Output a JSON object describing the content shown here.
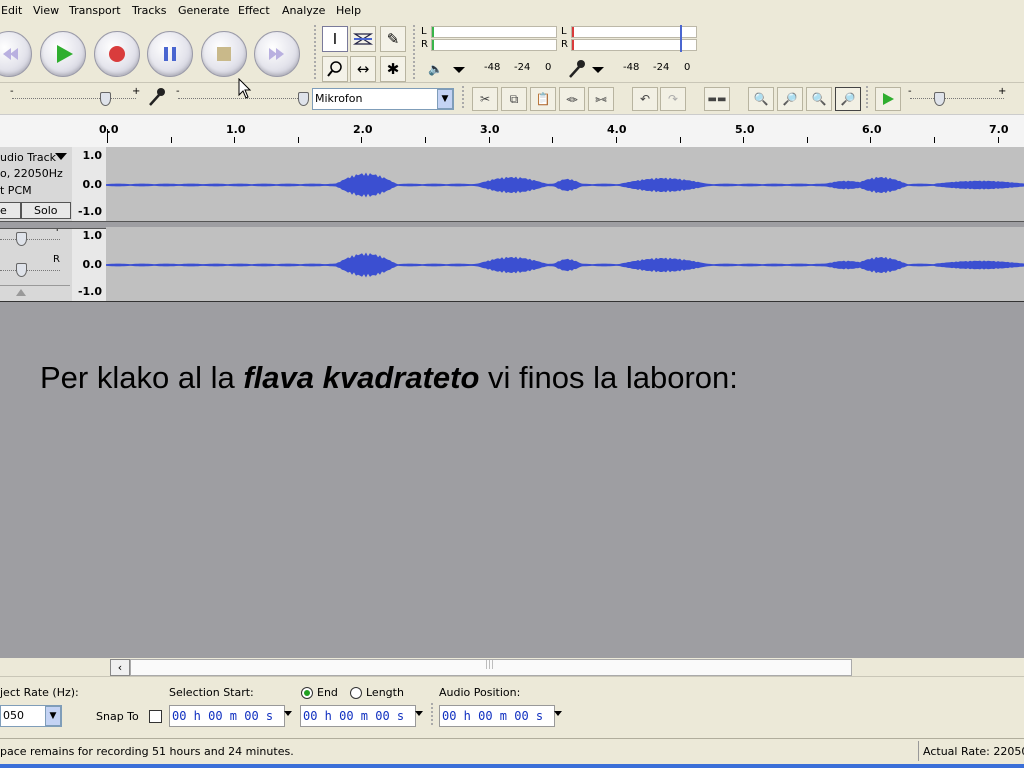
{
  "menu": [
    "Edit",
    "View",
    "Transport",
    "Tracks",
    "Generate",
    "Effect",
    "Analyze",
    "Help"
  ],
  "meters": {
    "play": {
      "l": "L",
      "r": "R",
      "ticks": [
        "-48",
        "-24",
        "0"
      ]
    },
    "record": {
      "l": "L",
      "r": "R",
      "ticks": [
        "-48",
        "-24",
        "0"
      ]
    }
  },
  "input_source": "Mikrofon",
  "ruler": [
    "0.0",
    "1.0",
    "2.0",
    "3.0",
    "4.0",
    "5.0",
    "6.0",
    "7.0"
  ],
  "track": {
    "name": "udio Track",
    "info1": "o, 22050Hz",
    "info2": "t PCM",
    "mute": "e",
    "solo": "Solo",
    "pan_r": "R",
    "gain_plus": "+",
    "scale": [
      "1.0",
      "0.0",
      "-1.0"
    ]
  },
  "slide": {
    "text_before": "Per klako al la ",
    "text_emph": "flava kvadrateto",
    "text_after": " vi finos la laboron:"
  },
  "selection": {
    "rate_label": "ject Rate (Hz):",
    "rate_value": "050",
    "start_label": "Selection Start:",
    "end_label": "End",
    "length_label": "Length",
    "position_label": "Audio Position:",
    "snap_label": "Snap To",
    "time_start": "00 h 00 m 00 s",
    "time_end": "00 h 00 m 00 s",
    "time_pos": "00 h 00 m 00 s"
  },
  "status": {
    "left": "pace remains for recording 51 hours and 24 minutes.",
    "right": "Actual Rate: 22050"
  },
  "colors": {
    "wave": "#3b4fd1",
    "play": "#2fae2f",
    "record": "#d93c3c"
  }
}
